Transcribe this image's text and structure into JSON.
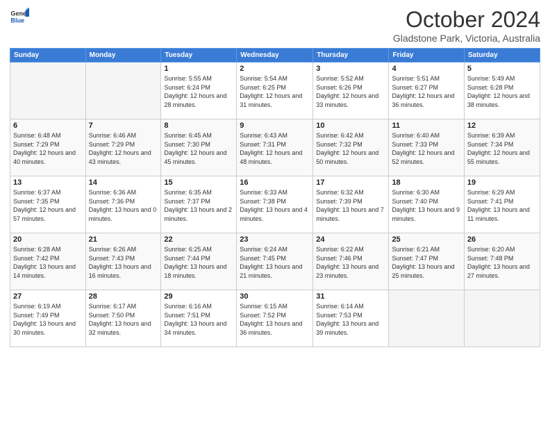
{
  "logo": {
    "general": "General",
    "blue": "Blue"
  },
  "title": "October 2024",
  "subtitle": "Gladstone Park, Victoria, Australia",
  "days_header": [
    "Sunday",
    "Monday",
    "Tuesday",
    "Wednesday",
    "Thursday",
    "Friday",
    "Saturday"
  ],
  "weeks": [
    [
      {
        "day": "",
        "info": ""
      },
      {
        "day": "",
        "info": ""
      },
      {
        "day": "1",
        "info": "Sunrise: 5:55 AM\nSunset: 6:24 PM\nDaylight: 12 hours and 28 minutes."
      },
      {
        "day": "2",
        "info": "Sunrise: 5:54 AM\nSunset: 6:25 PM\nDaylight: 12 hours and 31 minutes."
      },
      {
        "day": "3",
        "info": "Sunrise: 5:52 AM\nSunset: 6:26 PM\nDaylight: 12 hours and 33 minutes."
      },
      {
        "day": "4",
        "info": "Sunrise: 5:51 AM\nSunset: 6:27 PM\nDaylight: 12 hours and 36 minutes."
      },
      {
        "day": "5",
        "info": "Sunrise: 5:49 AM\nSunset: 6:28 PM\nDaylight: 12 hours and 38 minutes."
      }
    ],
    [
      {
        "day": "6",
        "info": "Sunrise: 6:48 AM\nSunset: 7:29 PM\nDaylight: 12 hours and 40 minutes."
      },
      {
        "day": "7",
        "info": "Sunrise: 6:46 AM\nSunset: 7:29 PM\nDaylight: 12 hours and 43 minutes."
      },
      {
        "day": "8",
        "info": "Sunrise: 6:45 AM\nSunset: 7:30 PM\nDaylight: 12 hours and 45 minutes."
      },
      {
        "day": "9",
        "info": "Sunrise: 6:43 AM\nSunset: 7:31 PM\nDaylight: 12 hours and 48 minutes."
      },
      {
        "day": "10",
        "info": "Sunrise: 6:42 AM\nSunset: 7:32 PM\nDaylight: 12 hours and 50 minutes."
      },
      {
        "day": "11",
        "info": "Sunrise: 6:40 AM\nSunset: 7:33 PM\nDaylight: 12 hours and 52 minutes."
      },
      {
        "day": "12",
        "info": "Sunrise: 6:39 AM\nSunset: 7:34 PM\nDaylight: 12 hours and 55 minutes."
      }
    ],
    [
      {
        "day": "13",
        "info": "Sunrise: 6:37 AM\nSunset: 7:35 PM\nDaylight: 12 hours and 57 minutes."
      },
      {
        "day": "14",
        "info": "Sunrise: 6:36 AM\nSunset: 7:36 PM\nDaylight: 13 hours and 0 minutes."
      },
      {
        "day": "15",
        "info": "Sunrise: 6:35 AM\nSunset: 7:37 PM\nDaylight: 13 hours and 2 minutes."
      },
      {
        "day": "16",
        "info": "Sunrise: 6:33 AM\nSunset: 7:38 PM\nDaylight: 13 hours and 4 minutes."
      },
      {
        "day": "17",
        "info": "Sunrise: 6:32 AM\nSunset: 7:39 PM\nDaylight: 13 hours and 7 minutes."
      },
      {
        "day": "18",
        "info": "Sunrise: 6:30 AM\nSunset: 7:40 PM\nDaylight: 13 hours and 9 minutes."
      },
      {
        "day": "19",
        "info": "Sunrise: 6:29 AM\nSunset: 7:41 PM\nDaylight: 13 hours and 11 minutes."
      }
    ],
    [
      {
        "day": "20",
        "info": "Sunrise: 6:28 AM\nSunset: 7:42 PM\nDaylight: 13 hours and 14 minutes."
      },
      {
        "day": "21",
        "info": "Sunrise: 6:26 AM\nSunset: 7:43 PM\nDaylight: 13 hours and 16 minutes."
      },
      {
        "day": "22",
        "info": "Sunrise: 6:25 AM\nSunset: 7:44 PM\nDaylight: 13 hours and 18 minutes."
      },
      {
        "day": "23",
        "info": "Sunrise: 6:24 AM\nSunset: 7:45 PM\nDaylight: 13 hours and 21 minutes."
      },
      {
        "day": "24",
        "info": "Sunrise: 6:22 AM\nSunset: 7:46 PM\nDaylight: 13 hours and 23 minutes."
      },
      {
        "day": "25",
        "info": "Sunrise: 6:21 AM\nSunset: 7:47 PM\nDaylight: 13 hours and 25 minutes."
      },
      {
        "day": "26",
        "info": "Sunrise: 6:20 AM\nSunset: 7:48 PM\nDaylight: 13 hours and 27 minutes."
      }
    ],
    [
      {
        "day": "27",
        "info": "Sunrise: 6:19 AM\nSunset: 7:49 PM\nDaylight: 13 hours and 30 minutes."
      },
      {
        "day": "28",
        "info": "Sunrise: 6:17 AM\nSunset: 7:50 PM\nDaylight: 13 hours and 32 minutes."
      },
      {
        "day": "29",
        "info": "Sunrise: 6:16 AM\nSunset: 7:51 PM\nDaylight: 13 hours and 34 minutes."
      },
      {
        "day": "30",
        "info": "Sunrise: 6:15 AM\nSunset: 7:52 PM\nDaylight: 13 hours and 36 minutes."
      },
      {
        "day": "31",
        "info": "Sunrise: 6:14 AM\nSunset: 7:53 PM\nDaylight: 13 hours and 39 minutes."
      },
      {
        "day": "",
        "info": ""
      },
      {
        "day": "",
        "info": ""
      }
    ]
  ]
}
